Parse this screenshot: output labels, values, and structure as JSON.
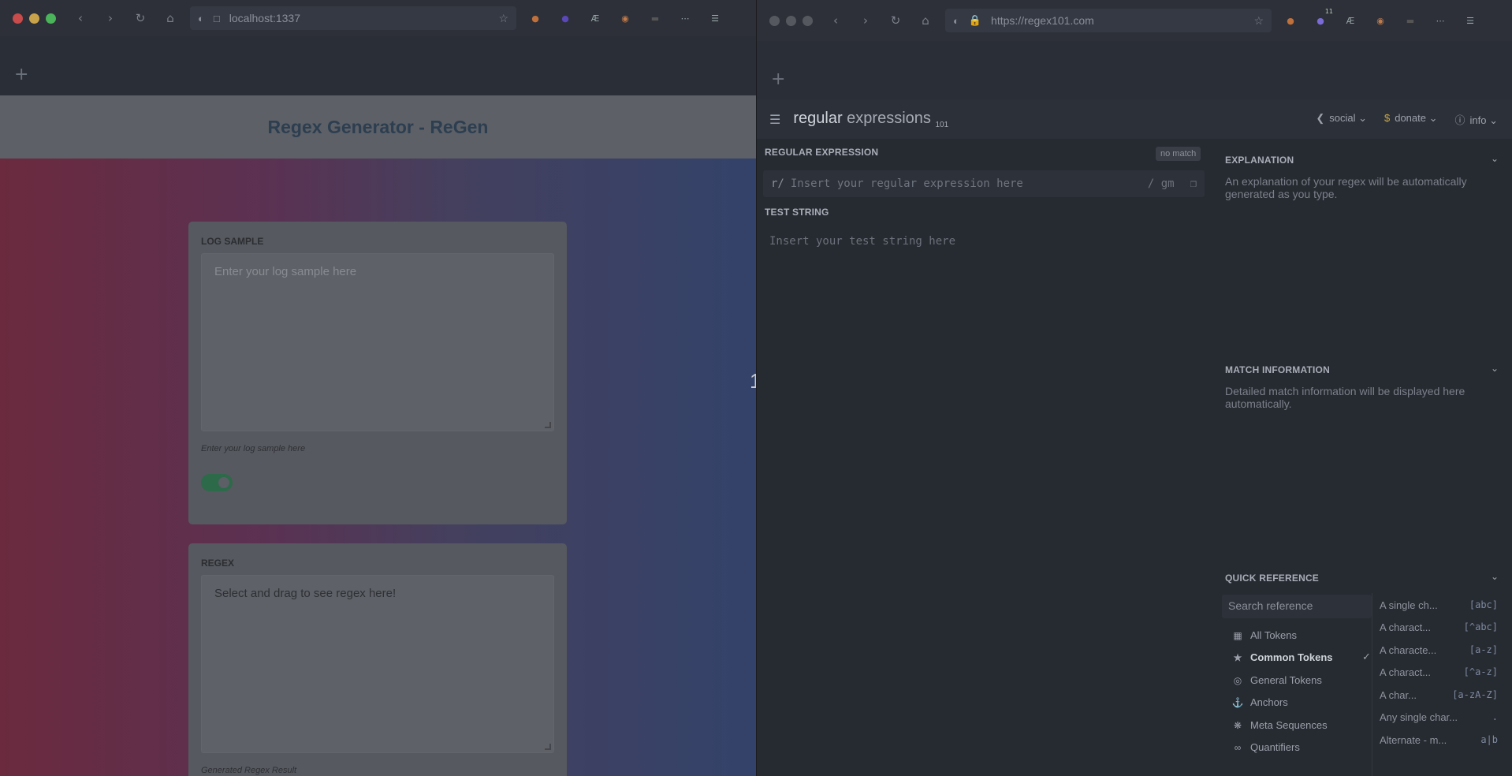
{
  "left_browser": {
    "url": "localhost:1337",
    "ext_icons": [
      "fox-icon",
      "purple-ext-icon",
      "text-ext-icon",
      "color-ext-icon",
      "dark-ext-icon"
    ]
  },
  "left_page": {
    "title": "Regex Generator - ReGen",
    "log_sample": {
      "label": "LOG SAMPLE",
      "placeholder": "Enter your log sample here",
      "hint": "Enter your log sample here"
    },
    "regex": {
      "label": "REGEX",
      "value": "Select and drag to see regex here!",
      "hint": "Generated Regex Result"
    }
  },
  "divider": {
    "label": "1"
  },
  "right_browser": {
    "url": "https://regex101.com",
    "ext_badge": "11"
  },
  "right_page": {
    "logo_main": "regular",
    "logo_light": " expressions",
    "logo_sub": "101",
    "menu": [
      {
        "icon": "share-icon",
        "label": "social"
      },
      {
        "icon": "dollar-icon",
        "label": "donate"
      },
      {
        "icon": "info-icon",
        "label": "info"
      }
    ],
    "regex_section": {
      "label": "REGULAR EXPRESSION",
      "badge": "no match",
      "delim": "r/",
      "placeholder": "Insert your regular expression here",
      "flags": "/ gm"
    },
    "test_section": {
      "label": "TEST STRING",
      "placeholder": "Insert your test string here"
    },
    "explanation": {
      "label": "EXPLANATION",
      "text": "An explanation of your regex will be automatically generated as you type."
    },
    "match_info": {
      "label": "MATCH INFORMATION",
      "text": "Detailed match information will be displayed here automatically."
    },
    "quick_ref": {
      "label": "QUICK REFERENCE",
      "search_placeholder": "Search reference",
      "categories": [
        {
          "icon": "lock-icon",
          "label": "All Tokens"
        },
        {
          "icon": "star-icon",
          "label": "Common Tokens"
        },
        {
          "icon": "circle-icon",
          "label": "General Tokens"
        },
        {
          "icon": "anchor-icon",
          "label": "Anchors"
        },
        {
          "icon": "asterisk-icon",
          "label": "Meta Sequences"
        },
        {
          "icon": "infinity-icon",
          "label": "Quantifiers"
        }
      ],
      "items": [
        {
          "label": "A single ch...",
          "token": "[abc]"
        },
        {
          "label": "A charact...",
          "token": "[^abc]"
        },
        {
          "label": "A characte...",
          "token": "[a-z]"
        },
        {
          "label": "A charact...",
          "token": "[^a-z]"
        },
        {
          "label": "A char...",
          "token": "[a-zA-Z]"
        },
        {
          "label": "Any single char...",
          "token": "."
        },
        {
          "label": "Alternate - m...",
          "token": "a|b"
        }
      ]
    }
  }
}
